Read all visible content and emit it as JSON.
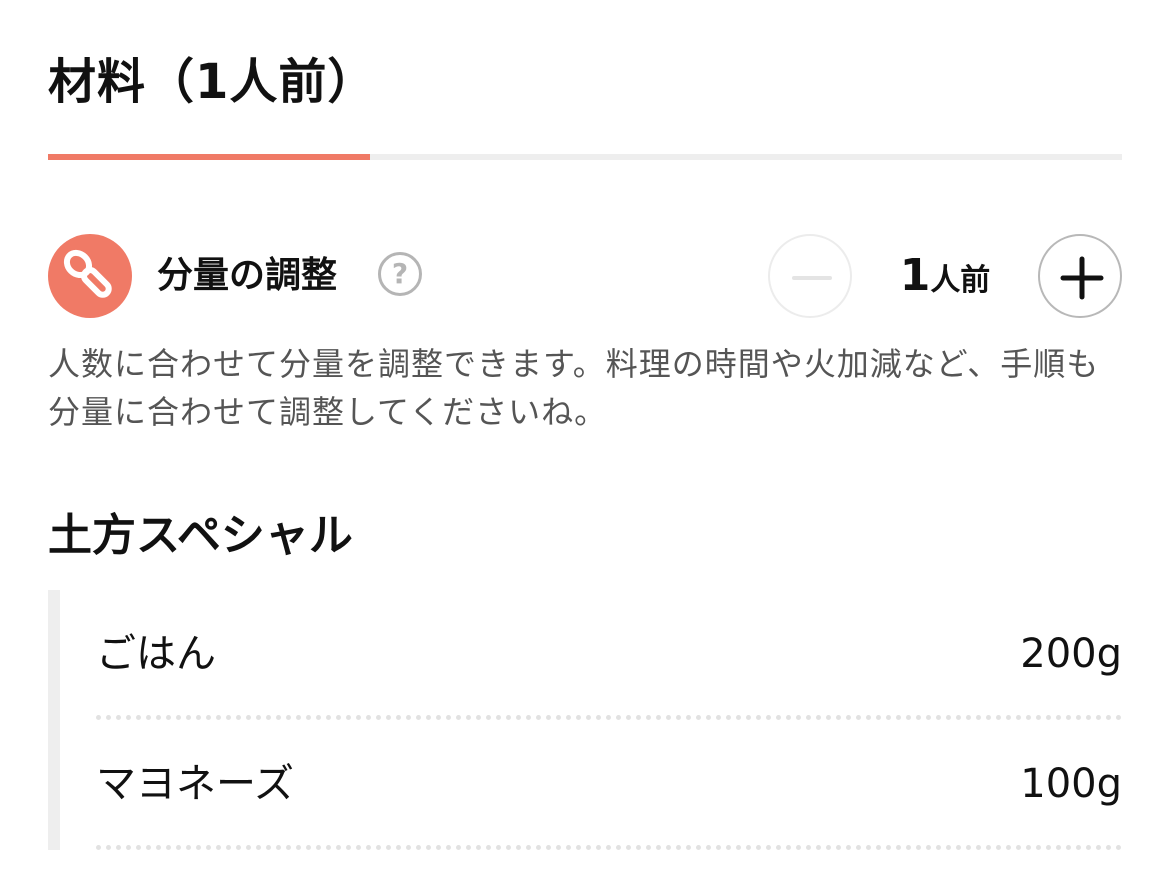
{
  "header": {
    "title": "材料（1人前）",
    "tab_progress": 0.3
  },
  "adjust": {
    "label": "分量の調整",
    "help_symbol": "?",
    "serving_count": "1",
    "serving_unit": "人前",
    "description": "人数に合わせて分量を調整できます。料理の時間や火加減など、手順も分量に合わせて調整してくださいね。"
  },
  "group": {
    "title": "土方スペシャル",
    "ingredients": [
      {
        "name": "ごはん",
        "amount": "200g"
      },
      {
        "name": "マヨネーズ",
        "amount": "100g"
      }
    ]
  },
  "icons": {
    "badge": "spoon-icon",
    "help": "question-circle-icon",
    "decrease": "minus-icon",
    "increase": "plus-icon"
  },
  "colors": {
    "accent": "#f07a66",
    "text": "#111111",
    "muted_text": "#555555",
    "disabled_border": "#ececec",
    "button_border": "#b8b8b8",
    "track": "#eeeeee"
  }
}
